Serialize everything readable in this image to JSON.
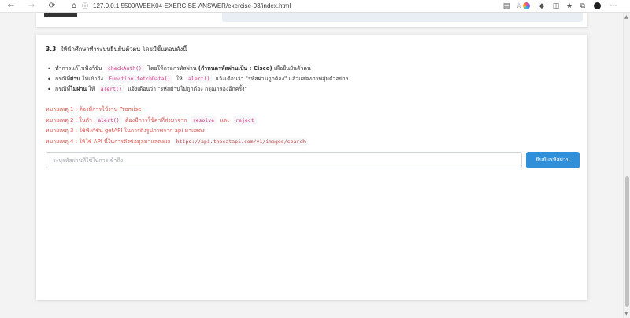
{
  "browser": {
    "url": "127.0.0.1:5500/WEEK04-EXERCISE-ANSWER/exercise-03/index.html"
  },
  "task": {
    "number": "3.3",
    "heading": "ให้นักศึกษาทำระบบยืนยันตัวตน โดยมีขั้นตอนดังนี้",
    "bullets": [
      {
        "p1": "ทำการแก้ไขฟังก์ชัน",
        "code1": "checkAuth()",
        "p2": "โดยให้กรอกรหัสผ่าน",
        "bold": "(กำหนดรหัสผ่านเป็น : Cisco)",
        "p3": "เพื่อยืนยันตัวตน"
      },
      {
        "p1": "กรณีที่",
        "bold": "ผ่าน",
        "p2": "ให้เข้าถึง",
        "code1": "Function fetchData()",
        "p3": "ให้",
        "code2": "alert()",
        "p4": "แจ้งเตือนว่า \"รหัสผ่านถูกต้อง\" แล้วแสดงภาพสุ่มตัวอย่าง"
      },
      {
        "p1": "กรณีที่",
        "bold": "ไม่ผ่าน",
        "p2": "ให้",
        "code1": "alert()",
        "p3": "แจ้งเตือนว่า \"รหัสผ่านไม่ถูกต้อง กรุณาลองอีกครั้ง\""
      }
    ],
    "notes": [
      {
        "tag": "หมายเหตุ 1 :",
        "text": "ต้องมีการใช้งาน Promise"
      },
      {
        "tag": "หมายเหตุ 2 :",
        "text": "ในตัว",
        "code1": "alert()",
        "text2": "ต้องมีการใช้ค่าที่ส่งมาจาก",
        "code2": "resolve",
        "text3": "และ",
        "code3": "reject"
      },
      {
        "tag": "หมายเหตุ 3 :",
        "text": "ใช้ฟังก์ชัน getAPI ในการดึงรูปภาพจาก api มาแสดง"
      },
      {
        "tag": "หมายเหตุ 4 :",
        "text": "ให้ใช้ API นี้ในการดึงข้อมูลมาแสดงผล",
        "url": "https://api.thecatapi.com/v1/images/search"
      }
    ]
  },
  "form": {
    "placeholder": "ระบุรหัสผ่านที่ใช้ในการเข้าถึง",
    "button": "ยืนยันรหัสผ่าน"
  },
  "colors": {
    "accent": "#2f8fd8",
    "note_red": "#d9534f",
    "code_pink": "#d63384"
  }
}
